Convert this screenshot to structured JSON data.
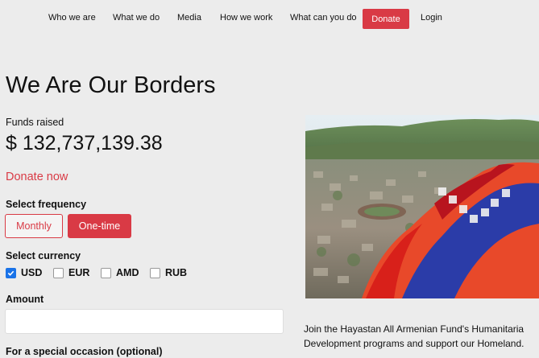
{
  "nav": {
    "items": [
      "Who we are",
      "What we do",
      "Media",
      "How we work",
      "What can you do"
    ],
    "donate": "Donate",
    "login": "Login"
  },
  "page": {
    "title": "We Are Our Borders",
    "funds_label": "Funds raised",
    "funds_value": "$ 132,737,139.38",
    "donate_now": "Donate now"
  },
  "frequency": {
    "label": "Select frequency",
    "options": [
      "Monthly",
      "One-time"
    ],
    "selected": "One-time"
  },
  "currency": {
    "label": "Select currency",
    "options": [
      "USD",
      "EUR",
      "AMD",
      "RUB"
    ],
    "selected": "USD"
  },
  "amount": {
    "label": "Amount",
    "value": "",
    "placeholder": ""
  },
  "occasion": {
    "label": "For a special occasion (optional)"
  },
  "description": {
    "line1": "Join the Hayastan All Armenian Fund's Humanitaria",
    "line2": "Development programs and support our Homeland."
  },
  "colors": {
    "accent": "#d93a45",
    "checkbox": "#1a73e8"
  }
}
